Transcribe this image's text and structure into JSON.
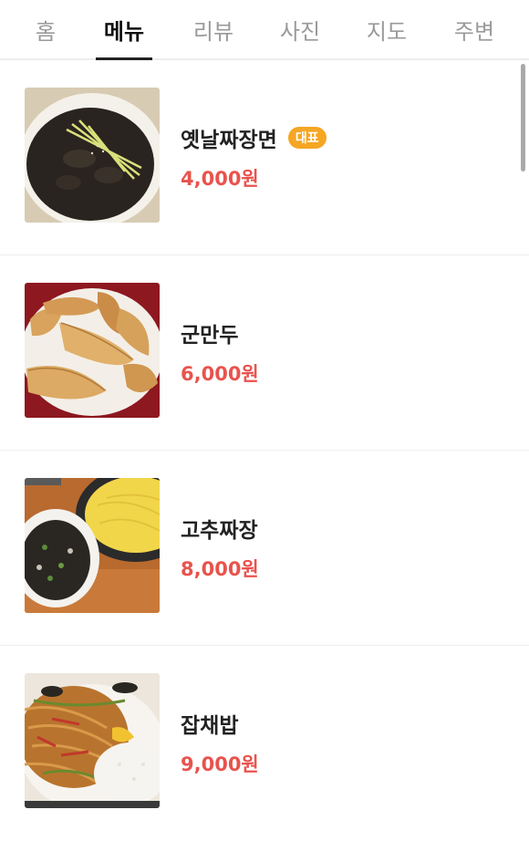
{
  "tabs": [
    {
      "label": "홈",
      "active": false
    },
    {
      "label": "메뉴",
      "active": true
    },
    {
      "label": "리뷰",
      "active": false
    },
    {
      "label": "사진",
      "active": false
    },
    {
      "label": "지도",
      "active": false
    },
    {
      "label": "주변",
      "active": false
    }
  ],
  "menu": [
    {
      "name": "옛날짜장면",
      "badge": "대표",
      "price": "4,000원"
    },
    {
      "name": "군만두",
      "badge": "",
      "price": "6,000원"
    },
    {
      "name": "고추짜장",
      "badge": "",
      "price": "8,000원"
    },
    {
      "name": "잡채밥",
      "badge": "",
      "price": "9,000원"
    }
  ],
  "colors": {
    "price": "#e8534d",
    "badge": "#f5a623",
    "active_tab": "#111111",
    "inactive_tab": "#9a9a9a"
  }
}
